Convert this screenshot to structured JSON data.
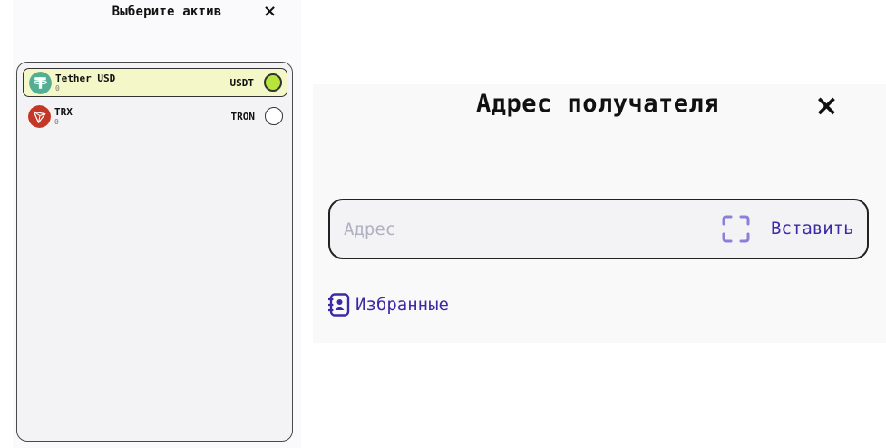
{
  "asset_picker": {
    "title": "Выберите актив",
    "close_glyph": "×",
    "assets": [
      {
        "name": "Tether USD",
        "balance": "0",
        "ticker": "USDT",
        "selected": true,
        "coin_color": "#53ae94",
        "icon": "tether-icon"
      },
      {
        "name": "TRX",
        "balance": "0",
        "ticker": "TRON",
        "selected": false,
        "coin_color": "#c43626",
        "icon": "tron-icon"
      }
    ]
  },
  "recipient": {
    "title": "Адрес получателя",
    "close_glyph": "×",
    "address_value": "",
    "address_placeholder": "Адрес",
    "scan_icon": "qr-scan-icon",
    "paste_label": "Вставить",
    "favorites_label": "Избранные",
    "favorites_icon": "contacts-book-icon",
    "accent_color": "#3b2aa6"
  }
}
